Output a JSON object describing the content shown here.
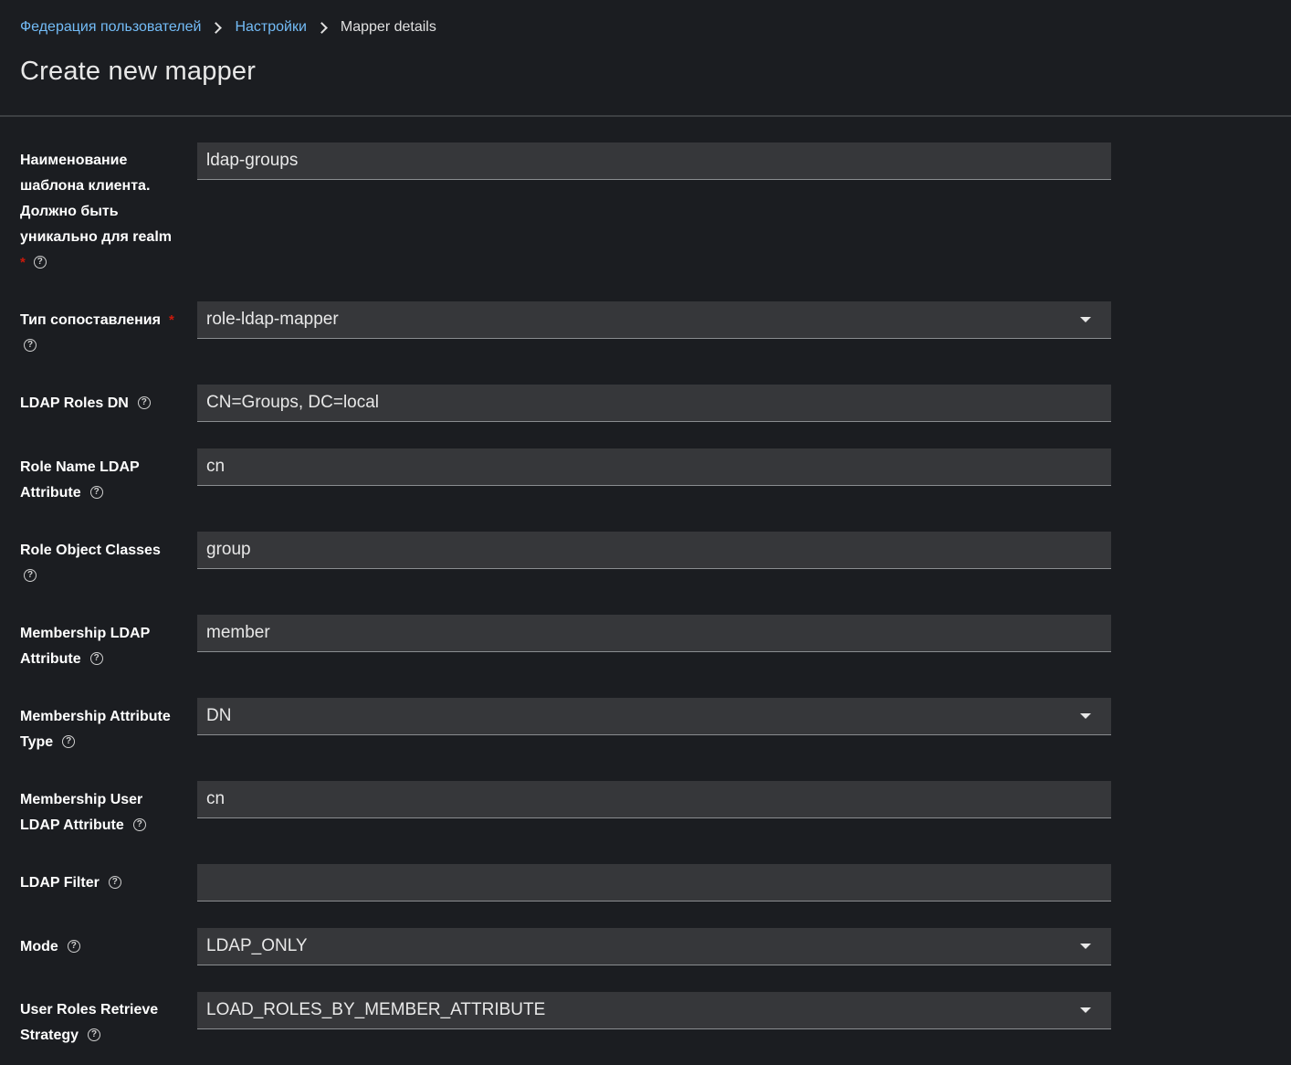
{
  "breadcrumb": {
    "items": [
      "Федерация пользователей",
      "Настройки"
    ],
    "current": "Mapper details"
  },
  "page": {
    "title": "Create new mapper"
  },
  "icons": {
    "help": "help-circle-icon",
    "separator": "chevron-right-icon",
    "dropdown": "caret-down-icon"
  },
  "form": {
    "name": {
      "label_lines": [
        "Наименование",
        "шаблона клиента.",
        "Должно быть",
        "уникально для realm"
      ],
      "required": "*",
      "value": "ldap-groups"
    },
    "mapper_type": {
      "label": "Тип сопоставления",
      "required": "*",
      "value": "role-ldap-mapper"
    },
    "ldap_roles_dn": {
      "label": "LDAP Roles DN",
      "value": "CN=Groups, DC=local"
    },
    "role_name_attr": {
      "label_lines": [
        "Role Name LDAP",
        "Attribute"
      ],
      "value": "cn"
    },
    "role_object_classes": {
      "label": "Role Object Classes",
      "value": "group"
    },
    "membership_attr": {
      "label_lines": [
        "Membership LDAP",
        "Attribute"
      ],
      "value": "member"
    },
    "membership_attr_type": {
      "label_lines": [
        "Membership Attribute",
        "Type"
      ],
      "value": "DN"
    },
    "membership_user_attr": {
      "label_lines": [
        "Membership User",
        "LDAP Attribute"
      ],
      "value": "cn"
    },
    "ldap_filter": {
      "label": "LDAP Filter",
      "value": ""
    },
    "mode": {
      "label": "Mode",
      "value": "LDAP_ONLY"
    },
    "retrieve_strategy": {
      "label_lines": [
        "User Roles Retrieve",
        "Strategy"
      ],
      "value": "LOAD_ROLES_BY_MEMBER_ATTRIBUTE"
    }
  }
}
